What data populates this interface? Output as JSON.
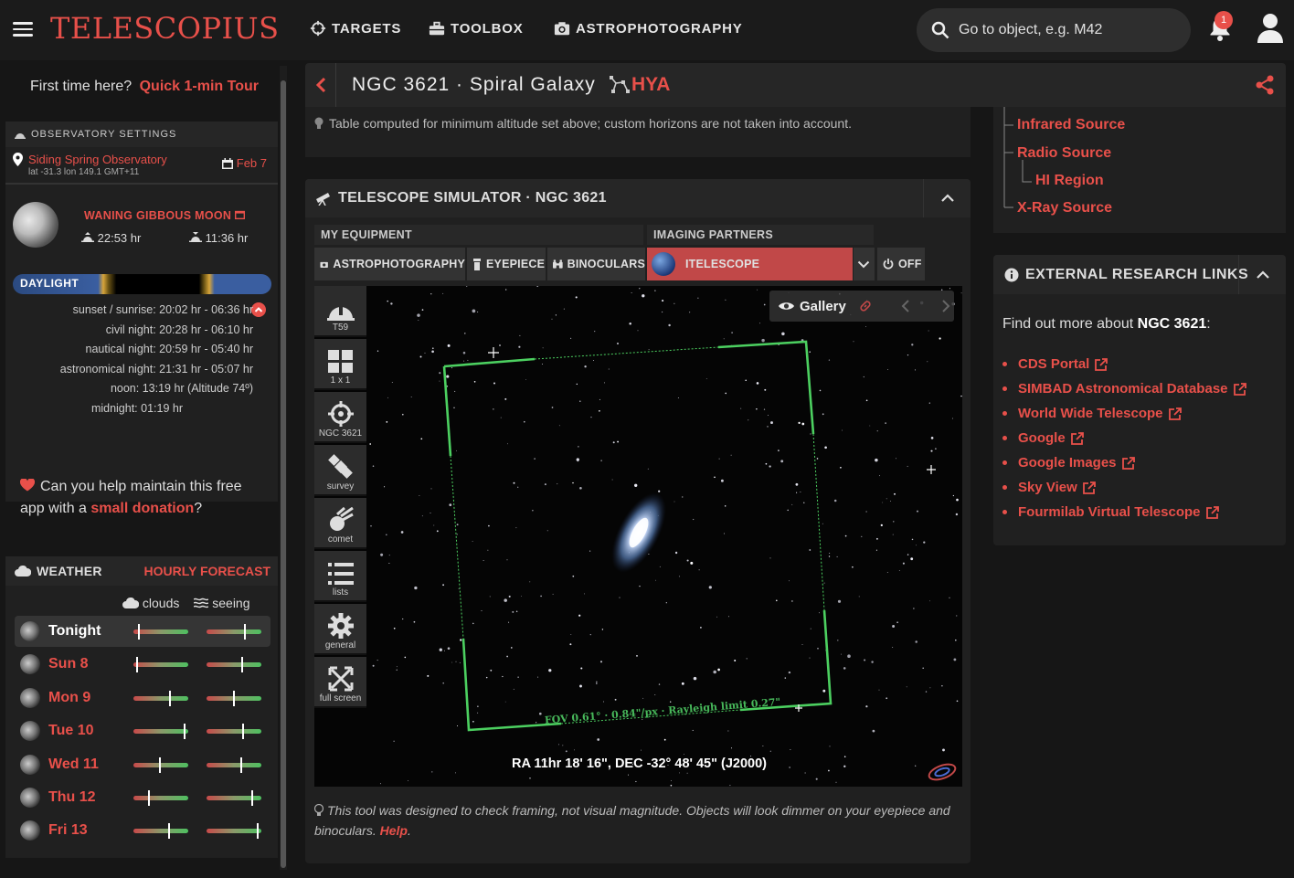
{
  "app": {
    "logo": "TELESCOPIUS",
    "nav": [
      "TARGETS",
      "TOOLBOX",
      "ASTROPHOTOGRAPHY"
    ],
    "search_placeholder": "Go to object, e.g. M42",
    "notification_count": "1",
    "accent": "#e8504a"
  },
  "sidebar": {
    "tour_prefix": "First time here?",
    "tour_link": "Quick 1-min Tour",
    "observatory": {
      "header": "OBSERVATORY SETTINGS",
      "site": "Siding Spring Observatory",
      "coords": "lat -31.3   lon 149.1   GMT+11",
      "date": "Feb 7"
    },
    "moon": {
      "phase": "WANING GIBBOUS MOON",
      "rise": "22:53 hr",
      "set": "11:36 hr"
    },
    "daylight_label": "DAYLIGHT",
    "sun_times": [
      "sunset / sunrise: 20:02 hr - 06:36 hr",
      "civil night: 20:28 hr - 06:10 hr",
      "nautical night: 20:59 hr - 05:40 hr",
      "astronomical night: 21:31 hr - 05:07 hr",
      "noon: 13:19 hr (Altitude 74º)",
      "midnight: 01:19 hr"
    ],
    "donate_text": "Can you help maintain this free app with a",
    "donate_link": "small donation",
    "donate_suffix": "?",
    "weather": {
      "header": "WEATHER",
      "forecast_link": "HOURLY FORECAST",
      "legend_clouds": "clouds",
      "legend_seeing": "seeing",
      "days": [
        {
          "name": "Tonight",
          "clouds": 0.08,
          "seeing": 0.7
        },
        {
          "name": "Sun 8",
          "clouds": 0.05,
          "seeing": 0.65
        },
        {
          "name": "Mon 9",
          "clouds": 0.68,
          "seeing": 0.5
        },
        {
          "name": "Tue 10",
          "clouds": 0.95,
          "seeing": 0.68
        },
        {
          "name": "Wed 11",
          "clouds": 0.48,
          "seeing": 0.64
        },
        {
          "name": "Thu 12",
          "clouds": 0.28,
          "seeing": 0.84
        },
        {
          "name": "Fri 13",
          "clouds": 0.65,
          "seeing": 0.95
        }
      ]
    }
  },
  "object": {
    "title": "NGC 3621 · Spiral Galaxy",
    "constellation": "HYA",
    "note": "Table computed for minimum altitude set above; custom horizons are not taken into account."
  },
  "simulator": {
    "header": "TELESCOPE SIMULATOR · NGC 3621",
    "my_equipment": "MY EQUIPMENT",
    "imaging_partners": "IMAGING PARTNERS",
    "buttons": {
      "astro": "ASTROPHOTOGRAPHY",
      "eyepiece": "EYEPIECE",
      "binoculars": "BINOCULARS",
      "partner": "ITELESCOPE",
      "off": "OFF"
    },
    "tools": [
      "T59",
      "1 x 1",
      "NGC 3621",
      "survey",
      "comet",
      "lists",
      "general",
      "full screen"
    ],
    "gallery": "Gallery",
    "fov": "FOV 0.61° · 0.84\"/px · Rayleigh limit 0.27\"",
    "radec": "RA 11hr 18' 16\", DEC -32° 48' 45\" (J2000)",
    "footer_text": "This tool was designed to check framing, not visual magnitude. Objects will look dimmer on your eyepiece and binoculars.",
    "footer_link": "Help"
  },
  "object_types": [
    "Infrared Source",
    "Radio Source",
    "HI Region",
    "X-Ray Source"
  ],
  "research": {
    "header": "EXTERNAL RESEARCH LINKS",
    "intro": "Find out more about",
    "object": "NGC 3621",
    "intro_suffix": ":",
    "links": [
      "CDS Portal",
      "SIMBAD Astronomical Database",
      "World Wide Telescope",
      "Google",
      "Google Images",
      "Sky View",
      "Fourmilab Virtual Telescope"
    ]
  }
}
